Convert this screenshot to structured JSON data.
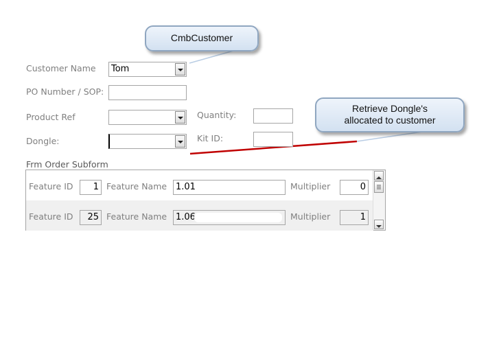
{
  "callouts": {
    "customer": "CmbCustomer",
    "dongle_line1": "Retrieve Dongle's",
    "dongle_line2": "allocated to customer"
  },
  "form": {
    "customer_name": {
      "label": "Customer Name",
      "value": "Tom"
    },
    "po_number": {
      "label": "PO Number / SOP:",
      "value": ""
    },
    "product_ref": {
      "label": "Product Ref",
      "value": ""
    },
    "dongle": {
      "label": "Dongle:",
      "value": ""
    },
    "quantity": {
      "label": "Quantity:",
      "value": ""
    },
    "kit_id": {
      "label": "Kit ID:",
      "value": ""
    }
  },
  "subform": {
    "label": "Frm  Order  Subform",
    "rows": [
      {
        "feature_id_label": "Feature ID",
        "feature_id": "1",
        "feature_name_label": "Feature Name",
        "feature_name": "1.01",
        "multiplier_label": "Multiplier",
        "multiplier": "0"
      },
      {
        "feature_id_label": "Feature ID",
        "feature_id": "25",
        "feature_name_label": "Feature Name",
        "feature_name": "1.06",
        "multiplier_label": "Multiplier",
        "multiplier": "1"
      }
    ]
  },
  "colors": {
    "annotation_line": "#c00000",
    "callout_fill": "#dce7f4",
    "alt_row": "#f0f0f0"
  }
}
